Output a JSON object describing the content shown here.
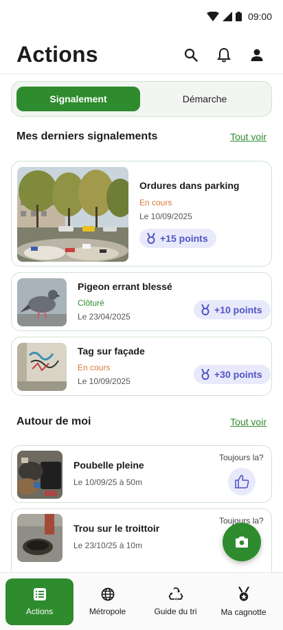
{
  "status_bar": {
    "time": "09:00"
  },
  "header": {
    "title": "Actions"
  },
  "tabs": [
    {
      "label": "Signalement",
      "active": true
    },
    {
      "label": "Démarche",
      "active": false
    }
  ],
  "sections": {
    "recent": {
      "title": "Mes derniers signalements",
      "see_all": "Tout voir"
    },
    "around": {
      "title": "Autour de moi",
      "see_all": "Tout voir"
    }
  },
  "recent_reports": [
    {
      "title": "Ordures dans parking",
      "status": "En cours",
      "date": "Le 10/09/2025",
      "points": "+15 points",
      "image": "garbage-in-parking"
    },
    {
      "title": "Pigeon errant blessé",
      "status": "Clôturé",
      "date": "Le 23/04/2025",
      "points": "+10 points",
      "image": "pigeon"
    },
    {
      "title": "Tag sur façade",
      "status": "En cours",
      "date": "Le 10/09/2025",
      "points": "+30 points",
      "image": "graffiti-wall"
    }
  ],
  "nearby": [
    {
      "title": "Poubelle pleine",
      "date": "Le 10/09/25 à 50m",
      "question": "Toujours la?",
      "image": "full-bin"
    },
    {
      "title": "Trou sur le troittoir",
      "date": "Le 23/10/25 à 10m",
      "question": "Toujours la?",
      "image": "pothole"
    }
  ],
  "bottom_nav": [
    {
      "label": "Actions",
      "icon": "list-icon",
      "active": true
    },
    {
      "label": "Métropole",
      "icon": "globe-icon",
      "active": false
    },
    {
      "label": "Guide du tri",
      "icon": "recycle-icon",
      "active": false
    },
    {
      "label": "Ma cagnotte",
      "icon": "medal-icon",
      "active": false
    }
  ],
  "colors": {
    "primary": "#2e8b2e",
    "ongoing": "#d9773a",
    "points_bg": "#e8e9fb",
    "points_text": "#5154c4"
  }
}
